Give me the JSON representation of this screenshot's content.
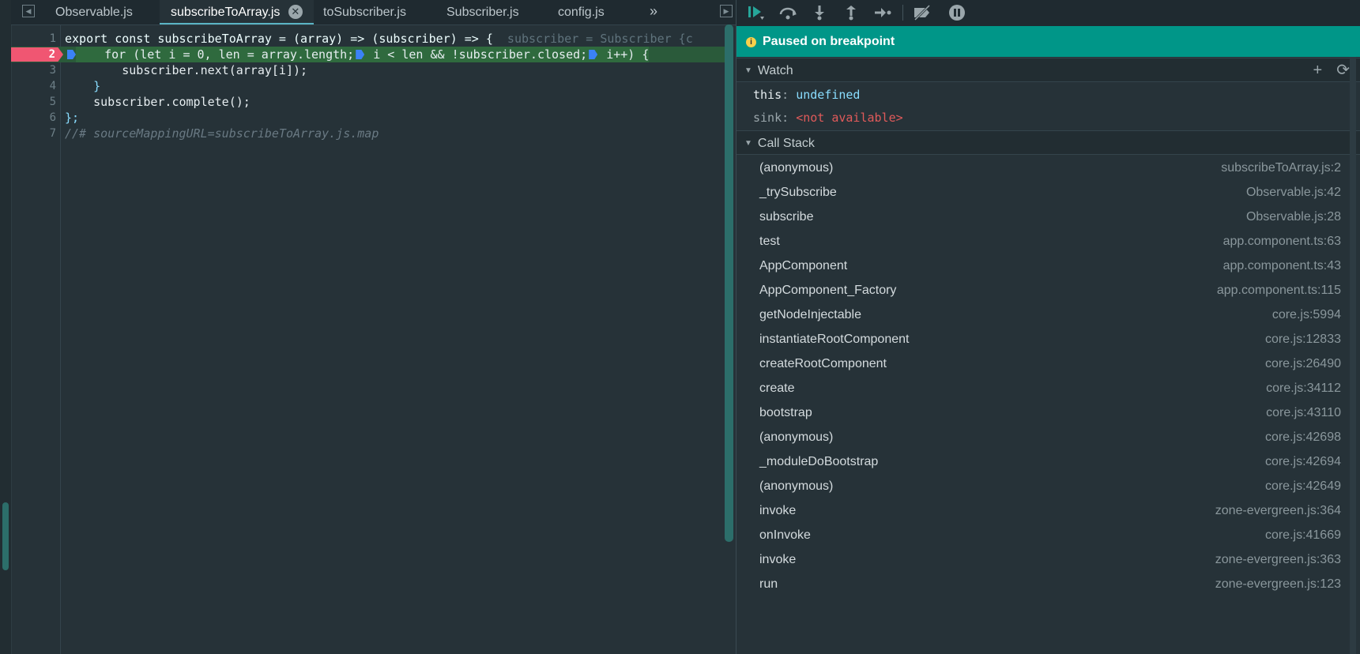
{
  "editor": {
    "tabs": [
      {
        "label": "Observable.js"
      },
      {
        "label": "subscribeToArray.js",
        "active": true
      },
      {
        "label": "toSubscriber.js"
      },
      {
        "label": "Subscriber.js"
      },
      {
        "label": "config.js"
      }
    ],
    "more_tabs_glyph": "»",
    "lines": [
      {
        "num": "1"
      },
      {
        "num": "2"
      },
      {
        "num": "3",
        "code": "        subscriber.next(array[i]);"
      },
      {
        "num": "4",
        "code": "    }"
      },
      {
        "num": "5",
        "code": "    subscriber.complete();"
      },
      {
        "num": "6",
        "code": "};"
      },
      {
        "num": "7",
        "code": "//# sourceMappingURL=subscribeToArray.js.map"
      }
    ],
    "line1": {
      "code": "export const subscribeToArray = (array) => (subscriber) => {",
      "inline_value": "subscriber = Subscriber {c"
    },
    "line2": {
      "part1": "    for (let i = 0, len = array.length;",
      "part2": " i < len && !subscriber.closed;",
      "part3": " i++) {"
    },
    "breakpoint_line": "2"
  },
  "debugger": {
    "toolbar_icons": [
      "resume-icon",
      "step-over-icon",
      "step-into-icon",
      "step-out-icon",
      "step-icon",
      "deactivate-breakpoints-icon",
      "pause-on-exceptions-icon"
    ],
    "paused_text": "Paused on breakpoint",
    "watch": {
      "title": "Watch",
      "items": [
        {
          "key": "this",
          "value": "undefined"
        },
        {
          "key": "sink",
          "value": "<not available>"
        }
      ]
    },
    "call_stack": {
      "title": "Call Stack",
      "frames": [
        {
          "name": "(anonymous)",
          "loc": "subscribeToArray.js:2"
        },
        {
          "name": "_trySubscribe",
          "loc": "Observable.js:42"
        },
        {
          "name": "subscribe",
          "loc": "Observable.js:28"
        },
        {
          "name": "test",
          "loc": "app.component.ts:63"
        },
        {
          "name": "AppComponent",
          "loc": "app.component.ts:43"
        },
        {
          "name": "AppComponent_Factory",
          "loc": "app.component.ts:115"
        },
        {
          "name": "getNodeInjectable",
          "loc": "core.js:5994"
        },
        {
          "name": "instantiateRootComponent",
          "loc": "core.js:12833"
        },
        {
          "name": "createRootComponent",
          "loc": "core.js:26490"
        },
        {
          "name": "create",
          "loc": "core.js:34112"
        },
        {
          "name": "bootstrap",
          "loc": "core.js:43110"
        },
        {
          "name": "(anonymous)",
          "loc": "core.js:42698"
        },
        {
          "name": "_moduleDoBootstrap",
          "loc": "core.js:42694"
        },
        {
          "name": "(anonymous)",
          "loc": "core.js:42649"
        },
        {
          "name": "invoke",
          "loc": "zone-evergreen.js:364"
        },
        {
          "name": "onInvoke",
          "loc": "core.js:41669"
        },
        {
          "name": "invoke",
          "loc": "zone-evergreen.js:363"
        },
        {
          "name": "run",
          "loc": "zone-evergreen.js:123"
        }
      ]
    }
  }
}
